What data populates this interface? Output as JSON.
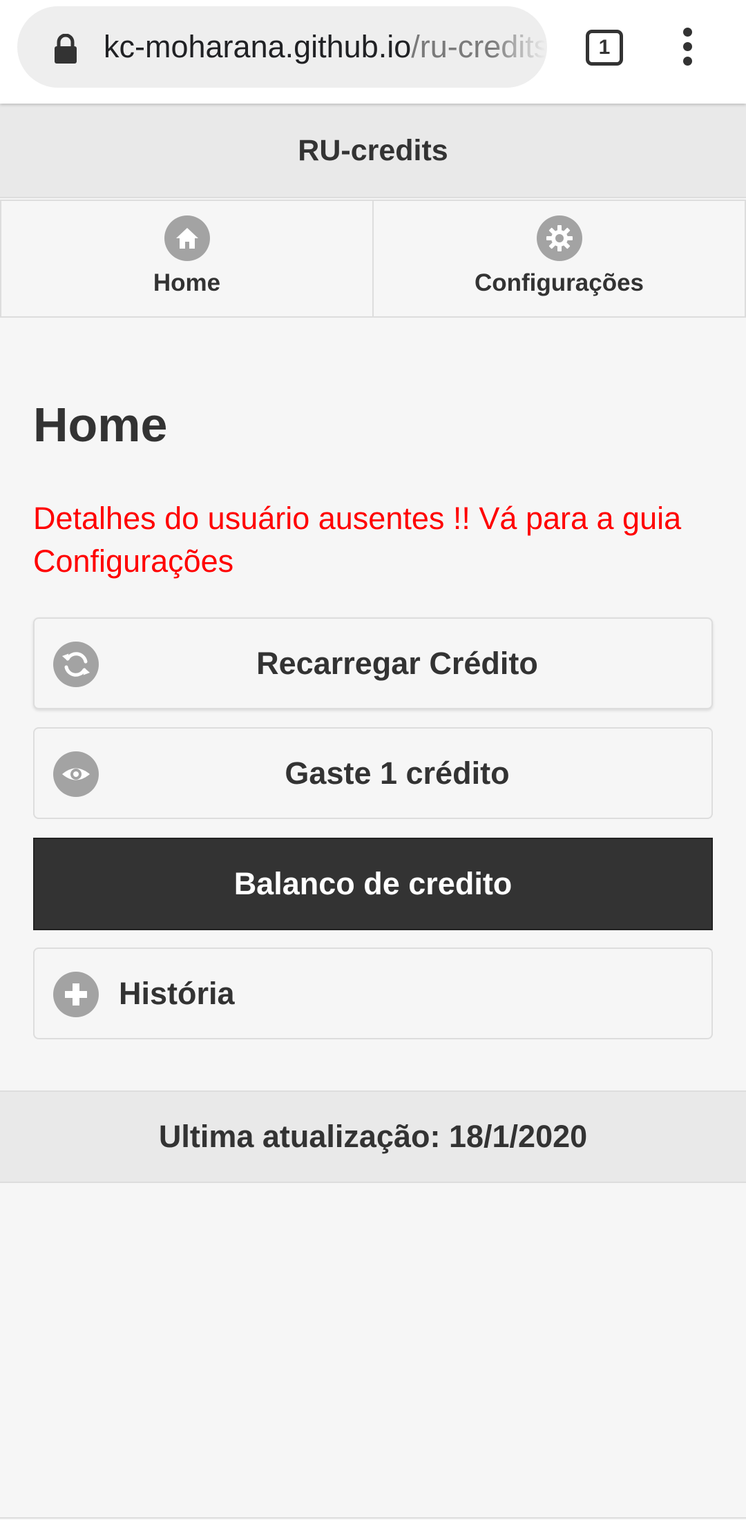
{
  "browser": {
    "url_host": "kc-moharana.github.io",
    "url_path": "/ru-credits",
    "tab_count": "1",
    "icons": [
      "lock-icon",
      "tabs-icon",
      "more-vert-icon"
    ]
  },
  "app": {
    "title": "RU-credits"
  },
  "nav": {
    "items": [
      {
        "label": "Home",
        "icon": "home-icon"
      },
      {
        "label": "Configurações",
        "icon": "gear-icon"
      }
    ]
  },
  "main": {
    "heading": "Home",
    "warning": "Detalhes do usuário ausentes !! Vá para a guia Configurações",
    "warning_color": "#ff0000",
    "buttons": {
      "reload": {
        "label": "Recarregar Crédito",
        "icon": "refresh-icon"
      },
      "spend": {
        "label": "Gaste 1 crédito",
        "icon": "eye-icon"
      },
      "balance": {
        "label": "Balanco de credito"
      },
      "history": {
        "label": "História",
        "icon": "plus-icon"
      }
    }
  },
  "footer": {
    "text": "Ultima atualização: 18/1/2020"
  },
  "colors": {
    "header_bg": "#e9e9e9",
    "page_bg": "#f6f6f6",
    "dark_button": "#333333",
    "icon_gray": "#a3a3a3"
  }
}
